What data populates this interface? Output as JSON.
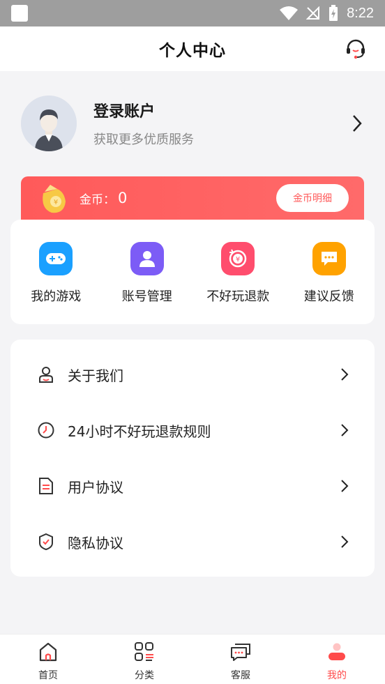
{
  "status_bar": {
    "time": "8:22"
  },
  "header": {
    "title": "个人中心",
    "service_icon": "headset-icon"
  },
  "profile": {
    "title": "登录账户",
    "subtitle": "获取更多优质服务"
  },
  "coins": {
    "label": "金币：",
    "value": "0",
    "detail_button": "金币明细"
  },
  "actions": [
    {
      "label": "我的游戏",
      "icon": "gamepad-icon",
      "color": "#1aa0ff"
    },
    {
      "label": "账号管理",
      "icon": "user-icon",
      "color": "#7c5cf6"
    },
    {
      "label": "不好玩退款",
      "icon": "refund-icon",
      "color": "#ff4d6d"
    },
    {
      "label": "建议反馈",
      "icon": "feedback-icon",
      "color": "#ffa200"
    }
  ],
  "menu": [
    {
      "label": "关于我们",
      "icon": "user-outline-icon"
    },
    {
      "label": "24小时不好玩退款规则",
      "icon": "clock-icon"
    },
    {
      "label": "用户协议",
      "icon": "document-icon"
    },
    {
      "label": "隐私协议",
      "icon": "shield-icon"
    }
  ],
  "bottom_nav": [
    {
      "label": "首页",
      "icon": "home-icon"
    },
    {
      "label": "分类",
      "icon": "category-icon"
    },
    {
      "label": "客服",
      "icon": "chat-icon"
    },
    {
      "label": "我的",
      "icon": "profile-icon",
      "active": true
    }
  ],
  "colors": {
    "accent": "#ff5a5a",
    "active_nav": "#ff4b4b"
  }
}
